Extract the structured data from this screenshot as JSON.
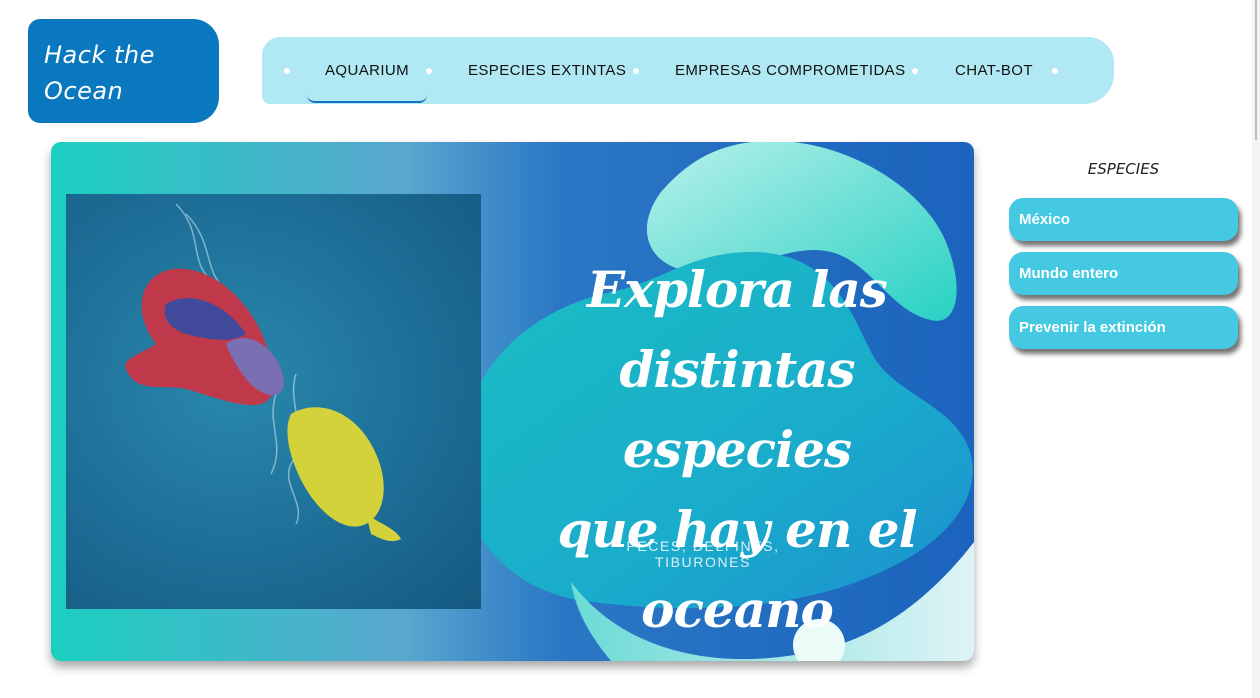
{
  "logo": {
    "line1": "Hack the",
    "line2": "Ocean"
  },
  "nav": {
    "items": [
      {
        "label": "AQUARIUM",
        "active": true
      },
      {
        "label": "ESPECIES EXTINTAS",
        "active": false
      },
      {
        "label": "EMPRESAS COMPROMETIDAS",
        "active": false
      },
      {
        "label": "CHAT-BOT",
        "active": false
      }
    ]
  },
  "hero": {
    "title_lines": [
      "Explora las",
      "distintas especies",
      "que hay en el oceano"
    ],
    "subtitle": "PECES, DELFINES, TIBURONES"
  },
  "sidebar": {
    "heading": "ESPECIES",
    "buttons": [
      {
        "label": "México"
      },
      {
        "label": "Mundo entero"
      },
      {
        "label": "Prevenir la extinción"
      }
    ]
  },
  "colors": {
    "logo_bg": "#0a78be",
    "nav_bg": "#b0e8f3",
    "sidebar_button_bg": "#45c9e3",
    "hero_teal": "#1bcfc0",
    "hero_blue": "#1b63bd"
  }
}
